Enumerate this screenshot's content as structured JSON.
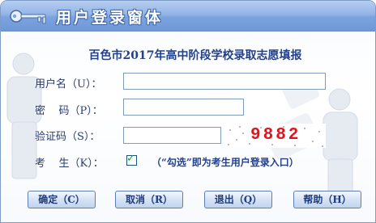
{
  "window": {
    "title": "用户登录窗体"
  },
  "form": {
    "heading": "百色市2017年高中阶段学校录取志愿填报",
    "username": {
      "label": "用户名（U）：",
      "value": ""
    },
    "password": {
      "label": "密    码（P）：",
      "value": ""
    },
    "verify_code": {
      "label": "验证码（S）：",
      "value": ""
    },
    "captcha_text": "9882",
    "candidate": {
      "label": "考    生（K）：",
      "checked": true,
      "hint": "（“勾选”即为考生用户登录入口）"
    }
  },
  "buttons": {
    "confirm": "确定（C）",
    "cancel": "取消（R）",
    "exit": "退出（Q）",
    "help": "帮助（H）"
  },
  "colors": {
    "titlebar": "#7ba3df",
    "heading": "#23408a",
    "captcha": "#e0141c",
    "check": "#21a121"
  }
}
